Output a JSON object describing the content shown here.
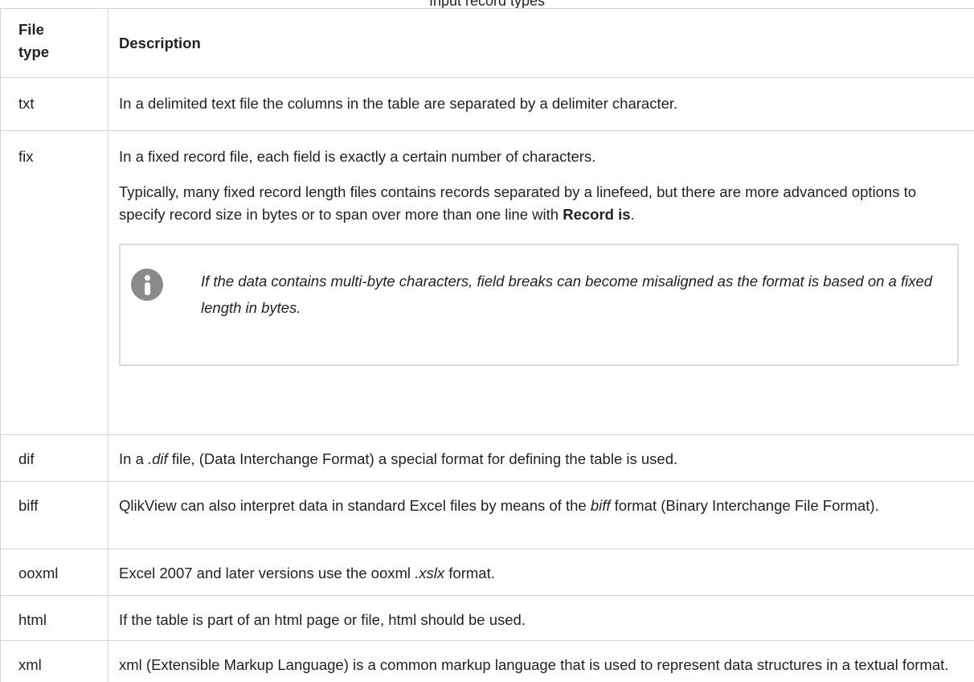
{
  "caption": "Input record types",
  "columns": {
    "file_type": "File type",
    "file_type_line1": "File",
    "file_type_line2": "type",
    "description": "Description"
  },
  "rows": {
    "txt": {
      "type": "txt",
      "desc": "In a delimited text file the columns in the table are separated by a delimiter character."
    },
    "fix": {
      "type": "fix",
      "desc1": "In a fixed record file, each field is exactly a certain number of characters.",
      "desc2_pre": "Typically, many fixed record length files contains records separated by a linefeed, but there are more advanced options to specify record size in bytes or to span over more than one line with ",
      "desc2_bold": "Record is",
      "desc2_post": ".",
      "note": "If the data contains multi-byte characters, field breaks can become misaligned as the format is based on a fixed length in bytes."
    },
    "dif": {
      "type": "dif",
      "desc_pre": "In a ",
      "desc_italic": ".dif",
      "desc_post": " file, (Data Interchange Format) a special format for defining the table is used."
    },
    "biff": {
      "type": "biff",
      "desc_pre": "QlikView can also interpret data in standard Excel files by means of the ",
      "desc_italic": "biff",
      "desc_post": " format (Binary Interchange File Format)."
    },
    "ooxml": {
      "type": "ooxml",
      "desc_pre": "Excel 2007 and later versions use the ooxml ",
      "desc_italic": ".xslx",
      "desc_post": " format."
    },
    "html": {
      "type": "html",
      "desc": "If the table is part of an html page or file, html should be used."
    },
    "xml": {
      "type": "xml",
      "desc": "xml (Extensible Markup Language) is a common markup language that is used to represent data structures in a textual format."
    }
  },
  "icons": {
    "note": "info-icon"
  },
  "colors": {
    "border": "#d4d4d4",
    "note_border": "#dcdcdc",
    "icon": "#8a8a8a",
    "text": "#222222"
  }
}
